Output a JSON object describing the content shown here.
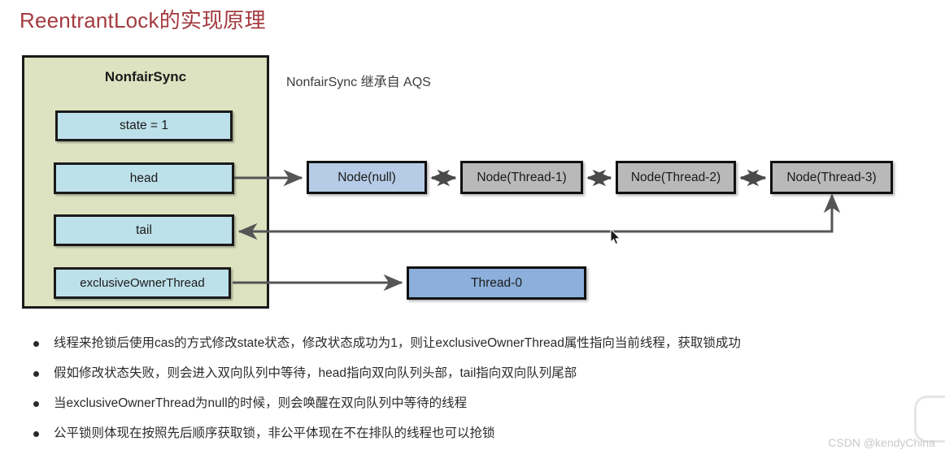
{
  "page": {
    "title": "ReentrantLock的实现原理",
    "title_color": "#a33a3f",
    "background": "#ffffff"
  },
  "diagram": {
    "container": {
      "name": "NonfairSync",
      "fill": "#dde3c0",
      "stroke": "#1a1a1a",
      "fields": [
        {
          "id": "state",
          "label": "state = 1",
          "fill": "#bde1ea"
        },
        {
          "id": "head",
          "label": "head",
          "fill": "#bde1ea"
        },
        {
          "id": "tail",
          "label": "tail",
          "fill": "#bde1ea"
        },
        {
          "id": "exclusiveOwnerThread",
          "label": "exclusiveOwnerThread",
          "fill": "#bde1ea"
        }
      ]
    },
    "note": "NonfairSync 继承自 AQS",
    "queue": {
      "nodes": [
        {
          "id": "node-null",
          "label": "Node(null)",
          "fill": "#b6cbe5"
        },
        {
          "id": "node-thread-1",
          "label": "Node(Thread-1)",
          "fill": "#b9b9b9"
        },
        {
          "id": "node-thread-2",
          "label": "Node(Thread-2)",
          "fill": "#b9b9b9"
        },
        {
          "id": "node-thread-3",
          "label": "Node(Thread-3)",
          "fill": "#b9b9b9"
        }
      ],
      "link_style": "double-headed-arrow"
    },
    "owner_thread": {
      "label": "Thread-0",
      "fill": "#8cb0db"
    },
    "arrows": [
      {
        "from": "head",
        "to": "node-null",
        "direction": "right"
      },
      {
        "from": "node-thread-3",
        "to": "tail",
        "direction": "left"
      },
      {
        "from": "tail",
        "to": "node-thread-3",
        "direction": "up"
      },
      {
        "from": "exclusiveOwnerThread",
        "to": "Thread-0",
        "direction": "right"
      }
    ]
  },
  "bullets": [
    "线程来抢锁后使用cas的方式修改state状态，修改状态成功为1，则让exclusiveOwnerThread属性指向当前线程，获取锁成功",
    "假如修改状态失败，则会进入双向队列中等待，head指向双向队列头部，tail指向双向队列尾部",
    "当exclusiveOwnerThread为null的时候，则会唤醒在双向队列中等待的线程",
    "公平锁则体现在按照先后顺序获取锁，非公平体现在不在排队的线程也可以抢锁"
  ],
  "watermark": {
    "text": "CSDN @kendyChina",
    "color": "#c9c9c9"
  }
}
